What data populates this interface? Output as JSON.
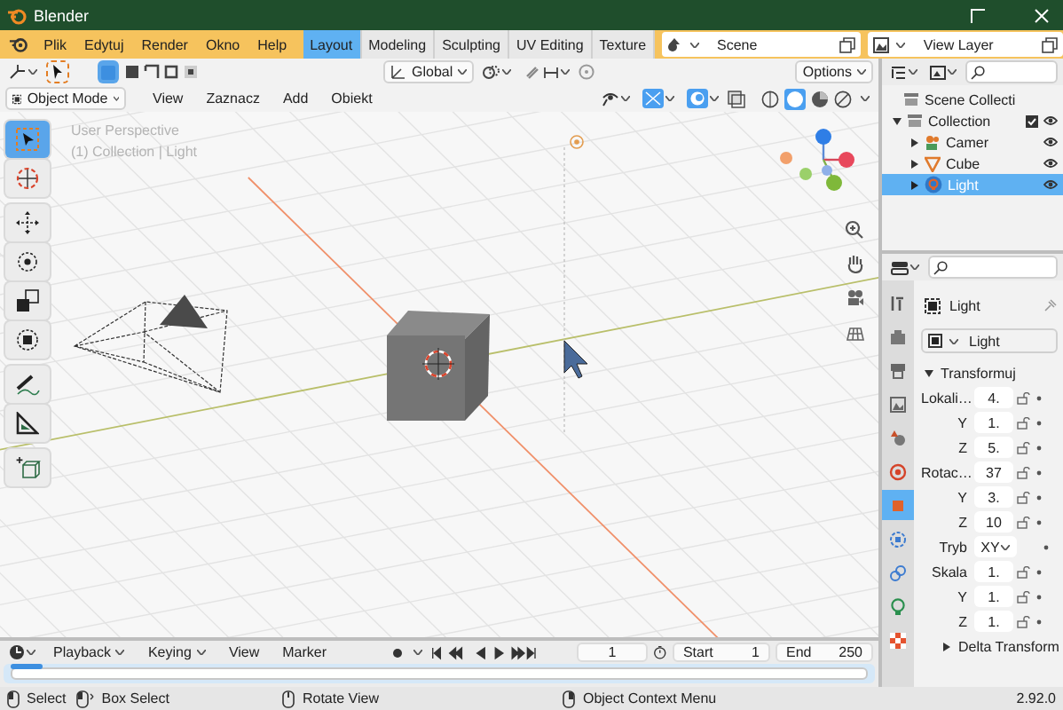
{
  "window": {
    "title": "Blender"
  },
  "menu": [
    "Plik",
    "Edytuj",
    "Render",
    "Okno",
    "Help"
  ],
  "workspaces": [
    {
      "label": "Layout",
      "selected": true
    },
    {
      "label": "Modeling",
      "selected": false
    },
    {
      "label": "Sculpting",
      "selected": false
    },
    {
      "label": "UV Editing",
      "selected": false
    },
    {
      "label": "Texture",
      "selected": false
    }
  ],
  "scene": "Scene",
  "view_layer": "View Layer",
  "viewport_header": {
    "orientation": "Global",
    "options": "Options",
    "mode": "Object Mode",
    "menus": [
      "View",
      "Zaznacz",
      "Add",
      "Obiekt"
    ]
  },
  "viewport": {
    "view_name": "User Perspective",
    "context": "(1) Collection | Light"
  },
  "toolbar": [
    {
      "tools": [
        {
          "kind": "select",
          "selected": true
        },
        {
          "kind": "cursor",
          "selected": false
        }
      ]
    },
    {
      "tools": [
        {
          "kind": "move",
          "selected": false
        },
        {
          "kind": "rotate",
          "selected": false
        },
        {
          "kind": "scale",
          "selected": false
        },
        {
          "kind": "transform",
          "selected": false
        }
      ]
    },
    {
      "tools": [
        {
          "kind": "annotate",
          "selected": false
        },
        {
          "kind": "measure",
          "selected": false
        }
      ]
    },
    {
      "tools": [
        {
          "kind": "add-cube",
          "selected": false
        }
      ]
    }
  ],
  "outliner": {
    "root": "Scene Collecti",
    "collection": {
      "label": "Collection",
      "expanded": true,
      "checked": true,
      "children": [
        {
          "label": "Camer",
          "kind": "camera",
          "selected": false
        },
        {
          "label": "Cube",
          "kind": "mesh",
          "selected": false
        },
        {
          "label": "Light",
          "kind": "light",
          "selected": true
        }
      ]
    }
  },
  "properties": {
    "tabs": [
      {
        "kind": "tool",
        "selected": false
      },
      {
        "kind": "render",
        "selected": false
      },
      {
        "kind": "output",
        "selected": false
      },
      {
        "kind": "view-layer",
        "selected": false
      },
      {
        "kind": "scene",
        "selected": false
      },
      {
        "kind": "world",
        "selected": false
      },
      {
        "kind": "object",
        "selected": true
      },
      {
        "kind": "physics",
        "selected": false
      },
      {
        "kind": "constraints",
        "selected": false
      },
      {
        "kind": "data",
        "selected": false
      },
      {
        "kind": "texture",
        "selected": false
      }
    ],
    "object_name": "Light",
    "data_name": "Light",
    "panel": {
      "title": "Transformuj",
      "expanded": true,
      "rows": [
        {
          "kind": "number",
          "label": "Lokali…",
          "value": "4."
        },
        {
          "kind": "number",
          "label": "Y",
          "value": "1."
        },
        {
          "kind": "number",
          "label": "Z",
          "value": "5."
        },
        {
          "kind": "number",
          "label": "Rotac…",
          "value": "37"
        },
        {
          "kind": "number",
          "label": "Y",
          "value": "3."
        },
        {
          "kind": "number",
          "label": "Z",
          "value": "10"
        },
        {
          "kind": "dropdown",
          "label": "Tryb",
          "value": "XY"
        },
        {
          "kind": "number",
          "label": "Skala",
          "value": "1."
        },
        {
          "kind": "number",
          "label": "Y",
          "value": "1."
        },
        {
          "kind": "number",
          "label": "Z",
          "value": "1."
        }
      ]
    },
    "subpanel": {
      "title": "Delta Transform",
      "expanded": false
    }
  },
  "timeline": {
    "menus": [
      {
        "label": "Playback",
        "dropdown": true
      },
      {
        "label": "Keying",
        "dropdown": true
      },
      {
        "label": "View",
        "dropdown": false
      },
      {
        "label": "Marker",
        "dropdown": false
      }
    ],
    "frame": "1",
    "start_label": "Start",
    "start": "1",
    "end_label": "End",
    "end": "250"
  },
  "status_bar": {
    "hints": [
      {
        "kind": "lmb",
        "label": "Select"
      },
      {
        "kind": "lmb-drag",
        "label": "Box Select"
      },
      {
        "kind": "mmb",
        "label": "Rotate View"
      },
      {
        "kind": "rmb",
        "label": "Object Context Menu"
      }
    ],
    "version": "2.92.0"
  }
}
